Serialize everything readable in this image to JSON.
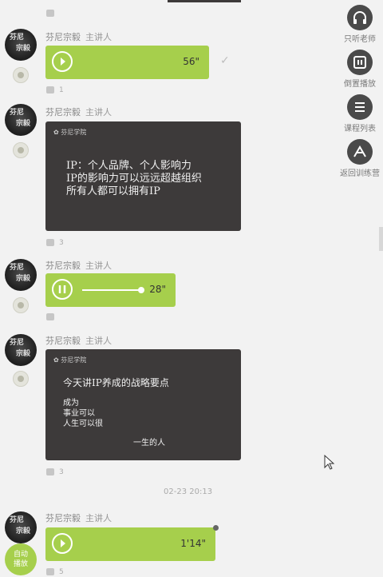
{
  "side_nav": [
    {
      "label": "只听老师",
      "icon": "headphones-icon"
    },
    {
      "label": "倒置播放",
      "icon": "reverse-play-icon"
    },
    {
      "label": "课程列表",
      "icon": "course-list-icon"
    },
    {
      "label": "返回训练营",
      "icon": "back-to-camp-icon"
    }
  ],
  "messages": [
    {
      "sender": "芬尼宗毅",
      "role": "主讲人",
      "type": "voice",
      "duration": "56\"",
      "likes": "1"
    },
    {
      "sender": "芬尼宗毅",
      "role": "主讲人",
      "type": "image",
      "lines": [
        "IP：个人品牌、个人影响力",
        "IP的影响力可以远远超越组织",
        "所有人都可以拥有IP"
      ],
      "likes": "3"
    },
    {
      "sender": "芬尼宗毅",
      "role": "主讲人",
      "type": "voice",
      "duration": "28\"",
      "progress": 0.95,
      "playing": true,
      "likes": ""
    },
    {
      "sender": "芬尼宗毅",
      "role": "主讲人",
      "type": "image",
      "lines": [
        "今天讲IP养成的战略要点",
        "成为",
        "事业可以",
        "人生可以很",
        "一生的人"
      ],
      "likes": "3"
    },
    {
      "sender": "芬尼宗毅",
      "role": "主讲人",
      "type": "voice",
      "duration": "1'14\"",
      "likes": "5"
    }
  ],
  "timestamp": "02-23 20:13",
  "auto_play_label": "自动播放",
  "card_logo_text": "芬尼学院",
  "accent_color": "#a6cf4c"
}
